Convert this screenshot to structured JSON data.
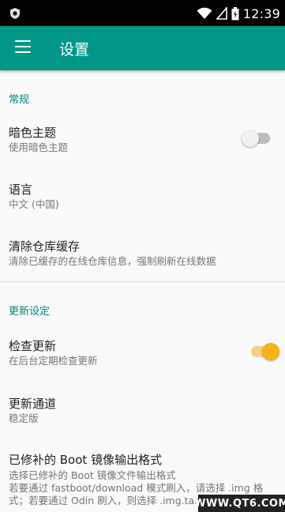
{
  "status_bar": {
    "time": "12:39",
    "icons": [
      "android-debug-icon",
      "wifi-icon",
      "signal-icon",
      "battery-icon"
    ]
  },
  "app_bar": {
    "title": "设置",
    "menu_icon": "hamburger-menu-icon",
    "color": "#009688"
  },
  "sections": [
    {
      "header": "常规",
      "items": [
        {
          "title": "暗色主题",
          "summary": "使用暗色主题",
          "switch": false
        },
        {
          "title": "语言",
          "summary": "中文 (中国)"
        },
        {
          "title": "清除仓库缓存",
          "summary": "清除已缓存的在线仓库信息，强制刷新在线数据"
        }
      ]
    },
    {
      "header": "更新设定",
      "items": [
        {
          "title": "检查更新",
          "summary": "在后台定期检查更新",
          "switch": true
        },
        {
          "title": "更新通道",
          "summary": "稳定版"
        },
        {
          "title": "已修补的 Boot 镜像输出格式",
          "summary_lines": [
            "选择已修补的 Boot 镜像文件输出格式",
            "若要通过 fastboot/download 模式刷入，请选择 .img 格",
            "式；若要通过 Odin 刷入，则选择 .img.tar 格式"
          ]
        }
      ]
    }
  ],
  "colors": {
    "accent": "#009688",
    "section_header": "#00897b",
    "switch_on": "#f5b316"
  },
  "watermark": "WWW.QT6.COM"
}
